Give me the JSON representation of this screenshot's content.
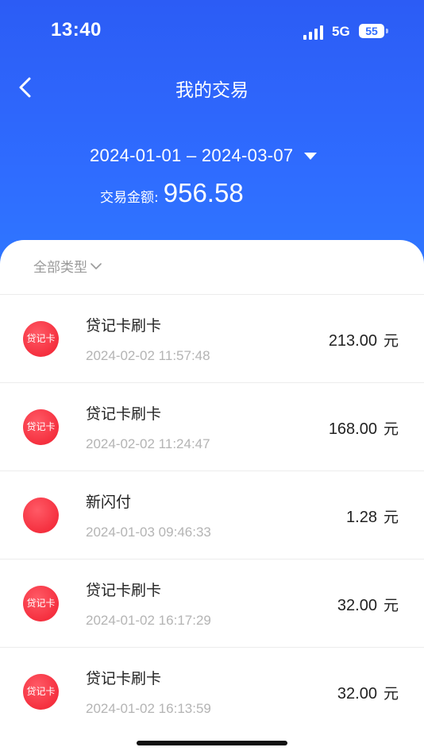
{
  "status_bar": {
    "time": "13:40",
    "network": "5G",
    "battery": "55"
  },
  "header": {
    "title": "我的交易"
  },
  "summary": {
    "date_range": "2024-01-01 – 2024-03-07",
    "amount_label": "交易金额:",
    "amount_value": "956.58"
  },
  "filter": {
    "label": "全部类型"
  },
  "transactions": [
    {
      "icon_text": "贷记卡",
      "name": "贷记卡刷卡",
      "time": "2024-02-02 11:57:48",
      "amount": "213.00",
      "unit": "元"
    },
    {
      "icon_text": "贷记卡",
      "name": "贷记卡刷卡",
      "time": "2024-02-02 11:24:47",
      "amount": "168.00",
      "unit": "元"
    },
    {
      "icon_text": "",
      "name": "新闪付",
      "time": "2024-01-03 09:46:33",
      "amount": "1.28",
      "unit": "元"
    },
    {
      "icon_text": "贷记卡",
      "name": "贷记卡刷卡",
      "time": "2024-01-02 16:17:29",
      "amount": "32.00",
      "unit": "元"
    },
    {
      "icon_text": "贷记卡",
      "name": "贷记卡刷卡",
      "time": "2024-01-02 16:13:59",
      "amount": "32.00",
      "unit": "元"
    }
  ],
  "colors": {
    "header_blue": "#2f6cff",
    "icon_red": "#f5303f"
  }
}
